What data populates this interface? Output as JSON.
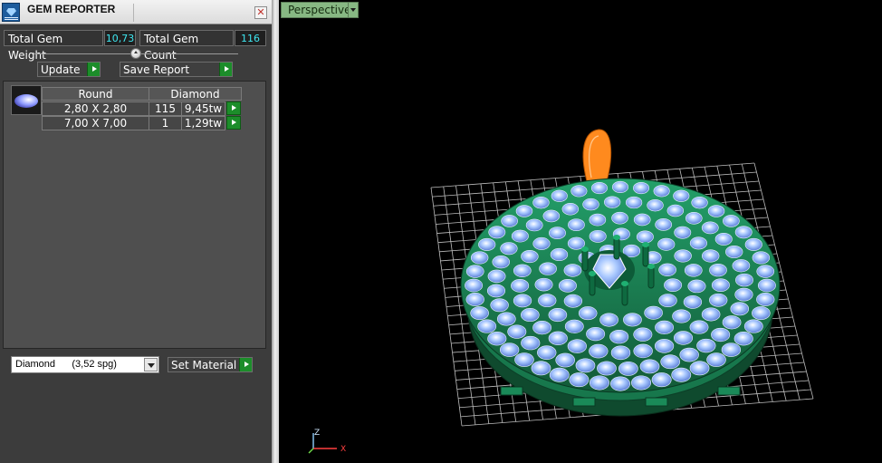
{
  "panel": {
    "title": "GEM REPORTER",
    "close_glyph": "✕"
  },
  "stats": {
    "weight_label": "Total Gem Weight",
    "weight_value": "10,73",
    "count_label": "Total Gem Count",
    "count_value": "116"
  },
  "actions": {
    "update_label": "Update",
    "save_label": "Save Report"
  },
  "report": {
    "headers": [
      "Round",
      "Diamond"
    ],
    "rows": [
      {
        "size": "2,80 X 2,80",
        "count": "115",
        "weight": "9,45tw"
      },
      {
        "size": "7,00 X 7,00",
        "count": "1",
        "weight": "1,29tw"
      }
    ]
  },
  "material": {
    "selected": "Diamond      (3,52 spg)",
    "set_label": "Set Material"
  },
  "viewport": {
    "view_mode": "Perspective",
    "axis_z": "Z",
    "axis_x": "X"
  },
  "colors": {
    "accent_green": "#1c8d2a",
    "value_cyan": "#3ee6f0",
    "model_green": "#1f8a5a",
    "gem_blue": "#8ab4f8",
    "bail_orange": "#ff8a1e"
  },
  "icons": {
    "app": "gem-reporter-icon",
    "close": "close-icon",
    "play": "play-icon",
    "dropdown": "chevron-down-icon"
  }
}
